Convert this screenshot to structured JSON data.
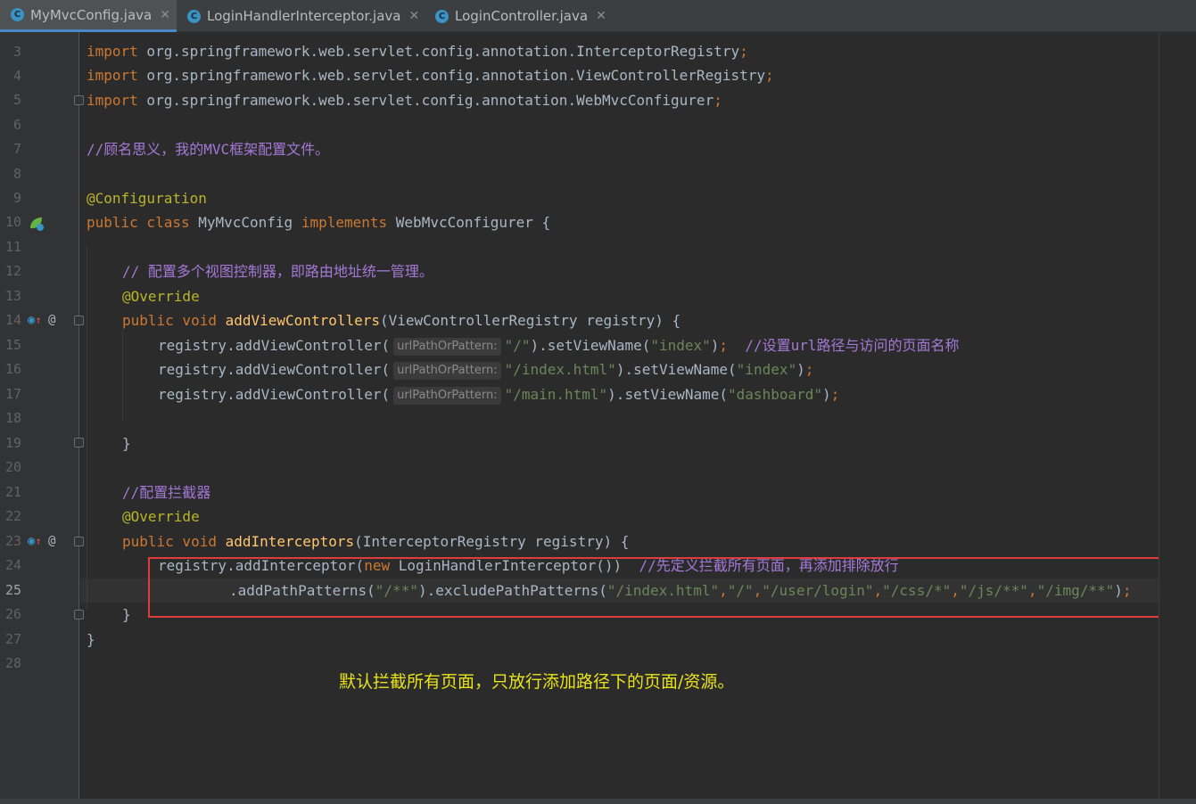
{
  "tabs": [
    {
      "label": "MyMvcConfig.java",
      "icon": "class-icon",
      "active": true
    },
    {
      "label": "LoginHandlerInterceptor.java",
      "icon": "class-icon",
      "active": false
    },
    {
      "label": "LoginController.java",
      "icon": "class-icon",
      "active": false
    }
  ],
  "gutter": {
    "line_numbers": [
      "3",
      "4",
      "5",
      "6",
      "7",
      "8",
      "9",
      "10",
      "11",
      "12",
      "13",
      "14",
      "15",
      "16",
      "17",
      "18",
      "19",
      "20",
      "21",
      "22",
      "23",
      "24",
      "25",
      "26",
      "27",
      "28"
    ],
    "current_line": "25"
  },
  "code": {
    "l3": {
      "kw": "import",
      "rest": " org.springframework.web.servlet.config.annotation.InterceptorRegistry",
      "semi": ";"
    },
    "l4": {
      "kw": "import",
      "rest": " org.springframework.web.servlet.config.annotation.ViewControllerRegistry",
      "semi": ";"
    },
    "l5": {
      "kw": "import",
      "rest": " org.springframework.web.servlet.config.annotation.WebMvcConfigurer",
      "semi": ";"
    },
    "l7": {
      "comment": "//顾名思义，我的MVC框架配置文件。"
    },
    "l9": {
      "annotation": "@Configuration"
    },
    "l10": {
      "kw1": "public class",
      "name": " MyMvcConfig ",
      "kw2": "implements",
      "rest": " WebMvcConfigurer {"
    },
    "l12": {
      "comment": "// 配置多个视图控制器，即路由地址统一管理。"
    },
    "l13": {
      "annotation": "@Override"
    },
    "l14": {
      "kw": "public void",
      "fn": "addViewControllers",
      "rest": "(ViewControllerRegistry registry) {"
    },
    "l15": {
      "pre": "registry.addViewController(",
      "hint": "urlPathOrPattern:",
      "str1": "\"/\"",
      "mid": ").setViewName(",
      "str2": "\"index\"",
      "post": ")",
      "semi": ";",
      "comment": "  //设置url路径与访问的页面名称"
    },
    "l16": {
      "pre": "registry.addViewController(",
      "hint": "urlPathOrPattern:",
      "str1": "\"/index.html\"",
      "mid": ").setViewName(",
      "str2": "\"index\"",
      "post": ")",
      "semi": ";"
    },
    "l17": {
      "pre": "registry.addViewController(",
      "hint": "urlPathOrPattern:",
      "str1": "\"/main.html\"",
      "mid": ").setViewName(",
      "str2": "\"dashboard\"",
      "post": ")",
      "semi": ";"
    },
    "l19": {
      "text": "}"
    },
    "l21": {
      "comment": "//配置拦截器"
    },
    "l22": {
      "annotation": "@Override"
    },
    "l23": {
      "kw": "public void",
      "fn": "addInterceptors",
      "rest": "(InterceptorRegistry registry) {"
    },
    "l24": {
      "pre": "registry.addInterceptor(",
      "kw": "new",
      "rest": " LoginHandlerInterceptor())",
      "comment": "  //先定义拦截所有页面，再添加排除放行"
    },
    "l25": {
      "pre": ".addPathPatterns(",
      "s1": "\"/**\"",
      "mid": ").excludePathPatterns(",
      "s2": "\"/index.html\"",
      "s3": "\"/\"",
      "s4": "\"/user/login\"",
      "s5": "\"/css/*\"",
      "s6": "\"/js/**\"",
      "s7": "\"/img/**\"",
      "comma": ",",
      "post": ")",
      "semi": ";"
    },
    "l26": {
      "text": "}"
    },
    "l27": {
      "text": "}"
    }
  },
  "annotation_note": "默认拦截所有页面，只放行添加路径下的页面/资源。",
  "colors": {
    "keyword": "#cc7832",
    "string": "#6a8759",
    "comment": "#a578d7",
    "annotation": "#bbb529",
    "function": "#ffc66d",
    "highlight_box": "#e03c3c",
    "note": "#e8e31a"
  }
}
